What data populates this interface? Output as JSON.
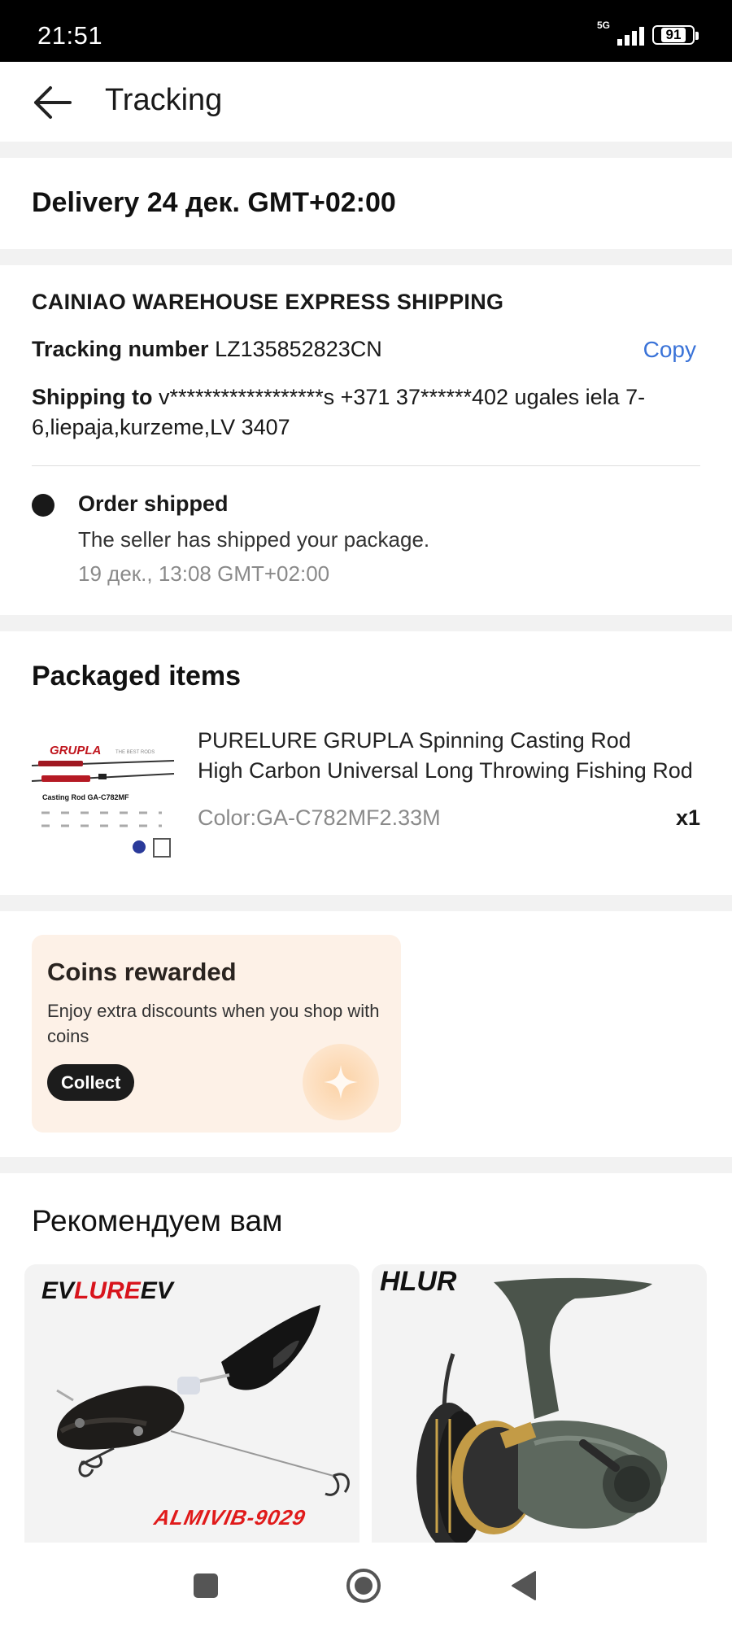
{
  "status_bar": {
    "time": "21:51",
    "network": "5G",
    "battery": "91"
  },
  "header": {
    "title": "Tracking"
  },
  "delivery": {
    "text": "Delivery 24 дек. GMT+02:00"
  },
  "shipping": {
    "carrier": "CAINIAO WAREHOUSE EXPRESS SHIPPING",
    "tracking_label": "Tracking number",
    "tracking_number": "LZ135852823CN",
    "copy_label": "Copy",
    "ship_to_label": "Shipping to",
    "address": "v******************s +371 37******402 ugales iela 7-6,liepaja,kurzeme,LV 3407",
    "event": {
      "title": "Order shipped",
      "description": "The seller has shipped your package.",
      "time": "19 дек., 13:08 GMT+02:00"
    }
  },
  "packaged": {
    "heading": "Packaged items",
    "product": {
      "title_line1": "PURELURE GRUPLA Spinning Casting Rod",
      "title_line2": "High Carbon Universal Long Throwing Fishing Rod",
      "variant": "Color:GA-C782MF2.33M",
      "quantity": "x1",
      "thumb_brand": "GRUPLA",
      "thumb_caption": "Casting Rod GA-C782MF"
    }
  },
  "coins": {
    "title": "Coins rewarded",
    "description": "Enjoy extra discounts when you shop with coins",
    "button": "Collect"
  },
  "recommendations": {
    "heading": "Рекомендуем вам",
    "items": [
      {
        "brand_prefix": "EV",
        "brand_mid": "LURE",
        "brand_suffix": "EV",
        "code": "ALMIVIB-9029"
      },
      {
        "brand": "HLUR"
      }
    ]
  },
  "colors": {
    "accent_link": "#3a73d8",
    "dark": "#191919",
    "coins_bg": "#fdf1e7",
    "brand_red": "#d8141c"
  }
}
